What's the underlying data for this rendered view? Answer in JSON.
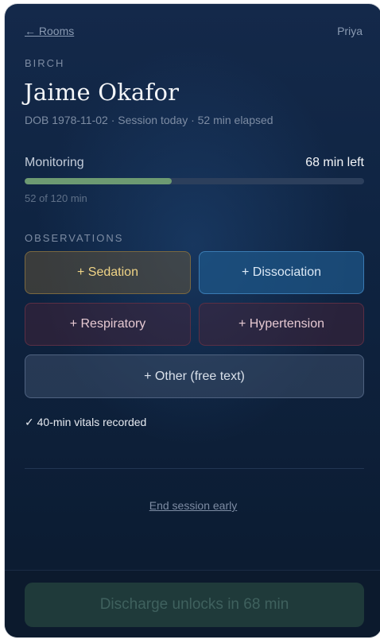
{
  "header": {
    "back_label": "← Rooms",
    "user_name": "Priya"
  },
  "patient": {
    "room": "BIRCH",
    "name": "Jaime Okafor",
    "meta": "DOB 1978-11-02 · Session today · 52 min elapsed"
  },
  "monitoring": {
    "label": "Monitoring",
    "time_left": "68 min left",
    "progress_text": "52 of 120 min",
    "progress_fraction": 0.433,
    "fill_color": "#6d9a72"
  },
  "observations": {
    "heading": "OBSERVATIONS",
    "buttons": [
      {
        "label": "+ Sedation",
        "color": "#f0d486"
      },
      {
        "label": "+ Dissociation",
        "color": "#3a7bb3"
      },
      {
        "label": "+ Respiratory",
        "color": "#5b2f44"
      },
      {
        "label": "+ Hypertension",
        "color": "#5b2f44"
      },
      {
        "label": "+ Other (free text)",
        "color": "#4f6280"
      }
    ]
  },
  "vitals_note": "✓ 40-min vitals recorded",
  "end_session_label": "End session early",
  "discharge": {
    "label": "Discharge unlocks in 68 min",
    "enabled": false
  }
}
